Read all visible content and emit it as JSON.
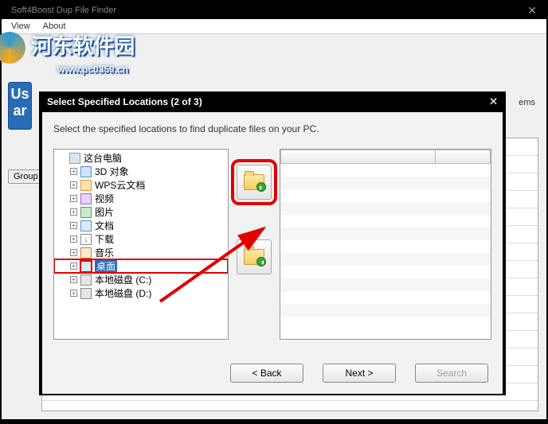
{
  "outer": {
    "title": "Soft4Boost Dup File Finder",
    "menu": {
      "view": "View",
      "about": "About"
    }
  },
  "watermark": {
    "text": "河东软件园",
    "url": "www.pc0359.cn"
  },
  "underlay": {
    "group_btn": "Group",
    "items_fragment": "ems"
  },
  "dialog": {
    "title": "Select Specified Locations (2 of 3)",
    "instruction": "Select the specified locations to find duplicate files on your PC.",
    "tree": [
      {
        "label": "这台电脑",
        "icon": "pc",
        "indent": 0,
        "expandable": false,
        "selected": false
      },
      {
        "label": "3D 对象",
        "icon": "3d",
        "indent": 1,
        "expandable": true,
        "selected": false
      },
      {
        "label": "WPS云文档",
        "icon": "wps",
        "indent": 1,
        "expandable": true,
        "selected": false
      },
      {
        "label": "视频",
        "icon": "video",
        "indent": 1,
        "expandable": true,
        "selected": false
      },
      {
        "label": "图片",
        "icon": "img",
        "indent": 1,
        "expandable": true,
        "selected": false
      },
      {
        "label": "文档",
        "icon": "doc",
        "indent": 1,
        "expandable": true,
        "selected": false
      },
      {
        "label": "下载",
        "icon": "down",
        "indent": 1,
        "expandable": true,
        "selected": false
      },
      {
        "label": "音乐",
        "icon": "music",
        "indent": 1,
        "expandable": true,
        "selected": false
      },
      {
        "label": "桌面",
        "icon": "desk",
        "indent": 1,
        "expandable": true,
        "selected": true
      },
      {
        "label": "本地磁盘 (C:)",
        "icon": "disk",
        "indent": 1,
        "expandable": true,
        "selected": false
      },
      {
        "label": "本地磁盘 (D:)",
        "icon": "disk",
        "indent": 1,
        "expandable": true,
        "selected": false
      }
    ],
    "buttons": {
      "back": "< Back",
      "next": "Next >",
      "search": "Search"
    }
  }
}
